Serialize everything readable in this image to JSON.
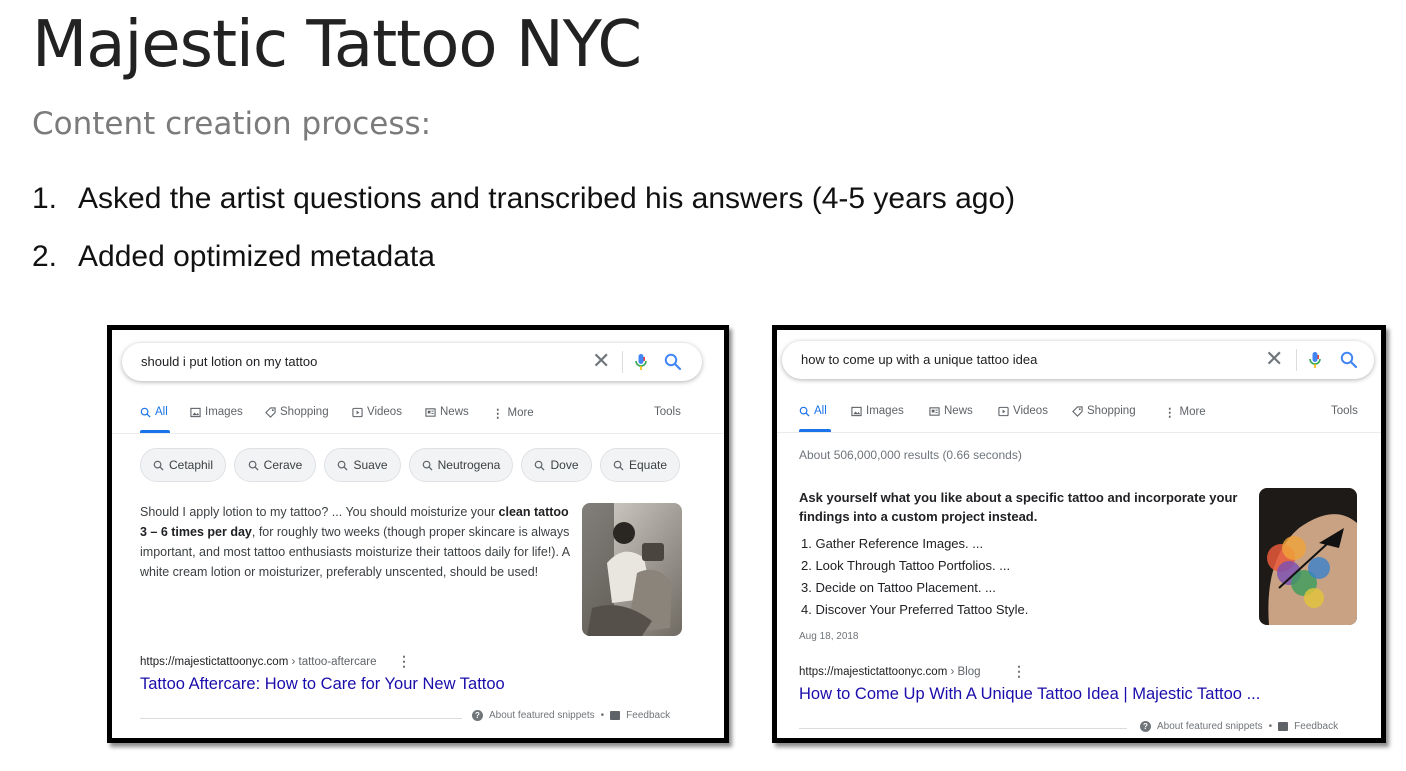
{
  "slide": {
    "title": "Majestic Tattoo NYC",
    "subtitle": "Content creation process:",
    "steps": [
      {
        "num": "1.",
        "text": "Asked the artist questions and transcribed his answers (4-5 years ago)"
      },
      {
        "num": "2.",
        "text": "Added optimized metadata"
      }
    ]
  },
  "result1": {
    "query": "should i put lotion on my tattoo",
    "tabs": [
      "All",
      "Images",
      "Shopping",
      "Videos",
      "News",
      "More"
    ],
    "tools": "Tools",
    "chips": [
      "Cetaphil",
      "Cerave",
      "Suave",
      "Neutrogena",
      "Dove",
      "Equate"
    ],
    "snippet": {
      "pre": "Should I apply lotion to my tattoo? ... You should moisturize your ",
      "bold": "clean tattoo 3 – 6 times per day",
      "post": ", for roughly two weeks (though proper skincare is always important, and most tattoo enthusiasts moisturize their tattoos daily for life!). A white cream lotion or moisturizer, preferably unscented, should be used!"
    },
    "url": "https://majestictattoonyc.com",
    "crumb": " › tattoo-aftercare",
    "link_title": "Tattoo Aftercare: How to Care for Your New Tattoo",
    "about": "About featured snippets",
    "sep": "•",
    "feedback": "Feedback"
  },
  "result2": {
    "query": "how to come up with a unique tattoo idea",
    "tabs": [
      "All",
      "Images",
      "News",
      "Videos",
      "Shopping",
      "More"
    ],
    "tools": "Tools",
    "count": "About 506,000,000 results (0.66 seconds)",
    "heading": "Ask yourself what you like about a specific tattoo and incorporate your findings into a custom project instead.",
    "list": [
      "1. Gather Reference Images. ...",
      "2. Look Through Tattoo Portfolios. ...",
      "3. Decide on Tattoo Placement. ...",
      "4. Discover Your Preferred Tattoo Style."
    ],
    "date": "Aug 18, 2018",
    "url": "https://majestictattoonyc.com",
    "crumb": " › Blog",
    "link_title": "How to Come Up With A Unique Tattoo Idea | Majestic Tattoo ...",
    "about": "About featured snippets",
    "sep": "•",
    "feedback": "Feedback"
  },
  "icons": {
    "search_color": "#4285f4",
    "active_tab_color": "#1a73e8",
    "link_color": "#1a0dab"
  }
}
